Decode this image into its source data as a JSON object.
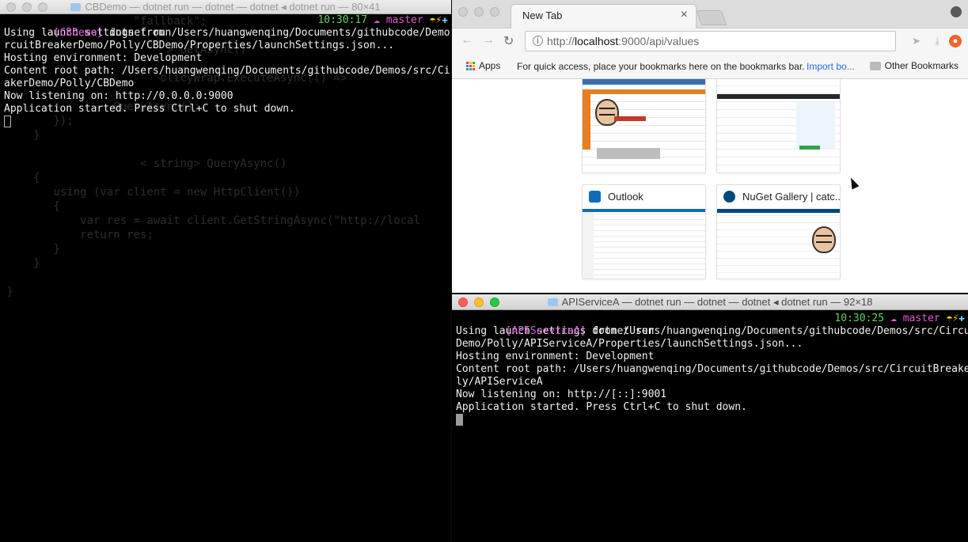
{
  "left_terminal": {
    "title": "CBDemo — dotnet run — dotnet — dotnet ◂ dotnet run — 80×41",
    "prompt_tag": "[CBDemo]",
    "command": " dotnet run",
    "time": "10:30:17",
    "branch": "master",
    "output": [
      "Using launch settings from /Users/huangwenqing/Documents/githubcode/Demos/src/Ci",
      "rcuitBreakerDemo/Polly/CBDemo/Properties/launchSettings.json...",
      "Hosting environment: Development",
      "Content root path: /Users/huangwenqing/Documents/githubcode/Demos/src/CircuitBre",
      "akerDemo/Polly/CBDemo",
      "Now listening on: http://0.0.0.0:9000",
      "Application started. Press Ctrl+C to shut down."
    ],
    "ghost_code": [
      "                    \"fallback\";",
      "",
      "                         > GetAsync()",
      "",
      "                        olicyWrap.ExecuteAsync(() =>",
      "",
      "                 QueryAsync();",
      "        });",
      "     }",
      "",
      "                     < string> QueryAsync()",
      "     {",
      "        using (var client = new HttpClient())",
      "        {",
      "            var res = await client.GetStringAsync(\"http://local",
      "            return res;",
      "        }",
      "     }",
      "",
      " }"
    ]
  },
  "browser": {
    "tab_title": "New Tab",
    "url_scheme": "http://",
    "url_host": "localhost",
    "url_rest": ":9000/api/values",
    "bookmarks": {
      "apps_label": "Apps",
      "hint": "For quick access, place your bookmarks here on the bookmarks bar.",
      "import_label": "Import bo...",
      "other_label": "Other Bookmarks"
    },
    "tiles": [
      {
        "title": "Outlook"
      },
      {
        "title": "NuGet Gallery | catc..."
      }
    ]
  },
  "right_terminal": {
    "title": "APIServiceA — dotnet run — dotnet — dotnet ◂ dotnet run — 92×18",
    "prompt_tag": "[APIServiceA]",
    "command": " dotnet run",
    "time": "10:30:25",
    "branch": "master",
    "output": [
      "Using launch settings from /Users/huangwenqing/Documents/githubcode/Demos/src/CircuitBreaker",
      "Demo/Polly/APIServiceA/Properties/launchSettings.json...",
      "Hosting environment: Development",
      "Content root path: /Users/huangwenqing/Documents/githubcode/Demos/src/CircuitBreakerDemo/Pol",
      "ly/APIServiceA",
      "Now listening on: http://[::]:9001",
      "Application started. Press Ctrl+C to shut down."
    ]
  },
  "colors": {
    "prompt_tag": "#d75fd7",
    "time": "#5fd75f",
    "branch": "#e05acf",
    "link": "#2a6be0"
  }
}
